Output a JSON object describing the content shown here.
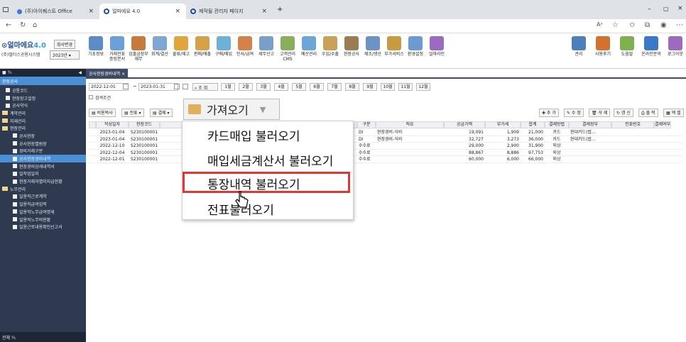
{
  "browser": {
    "tabs": [
      {
        "label": "(주)아이퀘스트 Office"
      },
      {
        "label": "얼마에요 4.0"
      },
      {
        "label": "제작될 관리자 페이지"
      }
    ],
    "add_tab": "+"
  },
  "app": {
    "logo": "얼마에요",
    "version": "4.0",
    "btn_company": "회사변경",
    "company": "(주)멀티스공용시스템",
    "year": "2023년",
    "menu": [
      {
        "label": "기초정보"
      },
      {
        "label": "거래전표\n증빙문서"
      },
      {
        "label": "입출금장부\n재무"
      },
      {
        "label": "회계/결산"
      },
      {
        "label": "물류/재고"
      },
      {
        "label": "판매/매출"
      },
      {
        "label": "구매/매입"
      },
      {
        "label": "인사/급여"
      },
      {
        "label": "세무신고"
      },
      {
        "label": "고객관리\nCMS"
      },
      {
        "label": "예산관리"
      },
      {
        "label": "수입/수출"
      },
      {
        "label": "현장공사"
      },
      {
        "label": "제조/생산"
      },
      {
        "label": "부가서비스"
      },
      {
        "label": "환경설정"
      },
      {
        "label": "얼마라인"
      }
    ],
    "menu_right": [
      {
        "label": "관리"
      },
      {
        "label": "사용후기"
      },
      {
        "label": "도움말"
      },
      {
        "label": "온라인문의"
      },
      {
        "label": "로그아웃"
      }
    ]
  },
  "sidebar": {
    "top": "■ ⅗",
    "section": "현장공사",
    "items": [
      {
        "label": "공통코드",
        "level": 1,
        "folder": false
      },
      {
        "label": "현장장고설정",
        "level": 1,
        "folder": false
      },
      {
        "label": "공사약식",
        "level": 1,
        "folder": false
      },
      {
        "label": "계약관리",
        "level": 0,
        "folder": true
      },
      {
        "label": "지재관리",
        "level": 0,
        "folder": true
      },
      {
        "label": "현장관리",
        "level": 0,
        "folder": true
      },
      {
        "label": "공사현장",
        "level": 1,
        "folder": false
      },
      {
        "label": "공사현장별원장",
        "level": 1,
        "folder": false
      },
      {
        "label": "경비거래구분",
        "level": 1,
        "folder": false
      },
      {
        "label": "공사현장경비내역",
        "level": 1,
        "folder": false,
        "selected": true
      },
      {
        "label": "현장경비상세내역서",
        "level": 1,
        "folder": false
      },
      {
        "label": "일작업일지",
        "level": 1,
        "folder": false
      },
      {
        "label": "현장거래처별미지급현황",
        "level": 1,
        "folder": false
      },
      {
        "label": "노무관리",
        "level": 0,
        "folder": true
      },
      {
        "label": "일용직근로계약",
        "level": 1,
        "folder": false
      },
      {
        "label": "일용직급여입력",
        "level": 1,
        "folder": false
      },
      {
        "label": "일용직노무급여명세",
        "level": 1,
        "folder": false
      },
      {
        "label": "일용직노무비현황",
        "level": 1,
        "folder": false
      },
      {
        "label": "일용근로내용확인신고서",
        "level": 1,
        "folder": false
      }
    ],
    "bottom": "전체 ⅗"
  },
  "page": {
    "tab": "공사현장경비내역",
    "date_from": "2022-12-01",
    "date_to": "2023-01-31",
    "search_btn": "조 회",
    "months": [
      "1월",
      "2월",
      "3월",
      "4월",
      "5월",
      "6월",
      "7월",
      "8월",
      "9월",
      "10월",
      "11월",
      "12월"
    ],
    "search_cond": "검색조건",
    "toolbar_left": [
      "비용복사",
      "전표",
      "결제"
    ],
    "toolbar_right": [
      "추 가",
      "수 정",
      "삭 제",
      "갱 신",
      "출 력",
      "엑 셀"
    ],
    "columns": [
      "작성일자",
      "현장코드",
      "",
      "구분",
      "적요",
      "공급가액",
      "부가세",
      "합계",
      "결제방법",
      "결제장부",
      "전표번호",
      "결제여부"
    ],
    "rows": [
      {
        "date": "2023-01-04",
        "code": "S230100001",
        "gubun": "DI",
        "memo": "현장경비-식비",
        "supply": "19,091",
        "vat": "1,909",
        "total": "21,000",
        "method": "카드",
        "book": "현대카드(법…"
      },
      {
        "date": "2023-01-04",
        "code": "S230100001",
        "gubun": "DI",
        "memo": "현장경비-식비",
        "supply": "32,727",
        "vat": "3,273",
        "total": "36,000",
        "method": "카드",
        "book": "현대카드(법…"
      },
      {
        "date": "2022-12-10",
        "code": "S230100001",
        "gubun": "수수료",
        "memo": "",
        "supply": "29,000",
        "vat": "2,900",
        "total": "31,900",
        "method": "외상",
        "book": ""
      },
      {
        "date": "2022-12-04",
        "code": "S230100001",
        "gubun": "수수료",
        "memo": "",
        "supply": "88,867",
        "vat": "8,886",
        "total": "97,753",
        "method": "외상",
        "book": ""
      },
      {
        "date": "2022-12-01",
        "code": "S230100001",
        "gubun": "수수료",
        "memo": "",
        "supply": "60,000",
        "vat": "6,000",
        "total": "66,000",
        "method": "외상",
        "book": ""
      }
    ]
  },
  "dropdown": {
    "button": "가져오기",
    "items": [
      "카드매입 불러오기",
      "매입세금계산서 불러오기",
      "통장내역 불러오기",
      "전표불러오기"
    ],
    "highlighted_index": 2,
    "highlight_color": "#e23535"
  }
}
